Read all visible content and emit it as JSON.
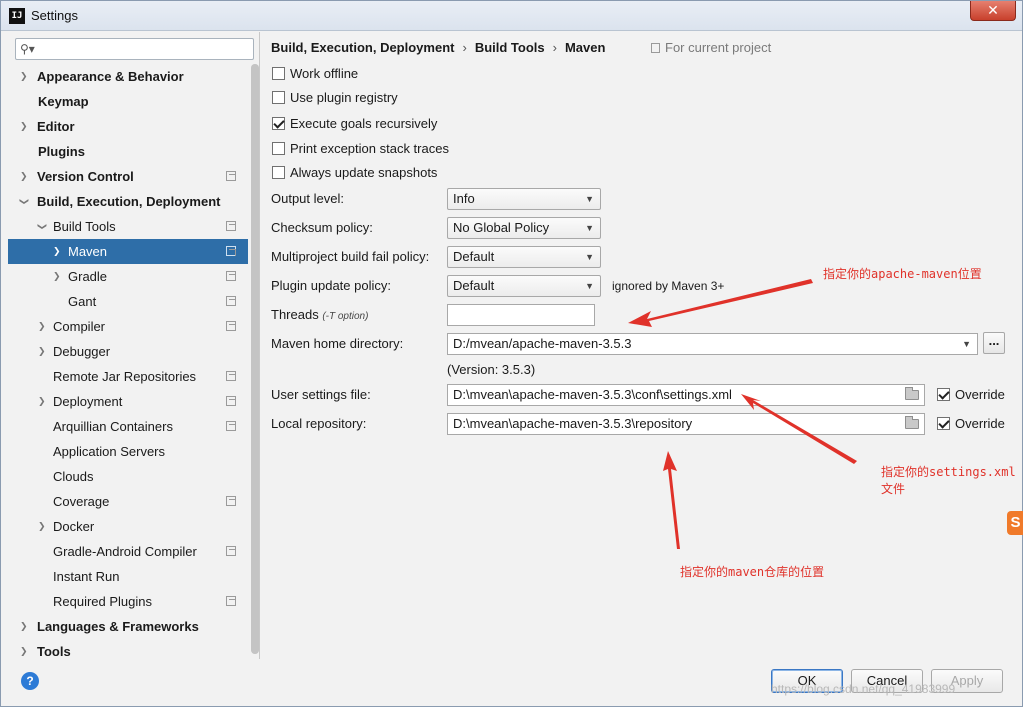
{
  "window": {
    "title": "Settings",
    "close_label": "✕"
  },
  "sidebar": {
    "search_placeholder": "",
    "items": [
      {
        "label": "Appearance & Behavior",
        "bold": true,
        "level": 0,
        "arrow": "right",
        "copy": false
      },
      {
        "label": "Keymap",
        "bold": true,
        "level": 0,
        "arrow": "none",
        "copy": false
      },
      {
        "label": "Editor",
        "bold": true,
        "level": 0,
        "arrow": "right",
        "copy": false
      },
      {
        "label": "Plugins",
        "bold": true,
        "level": 0,
        "arrow": "none",
        "copy": false
      },
      {
        "label": "Version Control",
        "bold": true,
        "level": 0,
        "arrow": "right",
        "copy": true
      },
      {
        "label": "Build, Execution, Deployment",
        "bold": true,
        "level": 0,
        "arrow": "down",
        "copy": false
      },
      {
        "label": "Build Tools",
        "bold": false,
        "level": 1,
        "arrow": "down",
        "copy": true
      },
      {
        "label": "Maven",
        "bold": false,
        "level": 2,
        "arrow": "right",
        "copy": true,
        "selected": true
      },
      {
        "label": "Gradle",
        "bold": false,
        "level": 2,
        "arrow": "right",
        "copy": true
      },
      {
        "label": "Gant",
        "bold": false,
        "level": 2,
        "arrow": "none",
        "copy": true
      },
      {
        "label": "Compiler",
        "bold": false,
        "level": 1,
        "arrow": "right",
        "copy": true
      },
      {
        "label": "Debugger",
        "bold": false,
        "level": 1,
        "arrow": "right",
        "copy": false
      },
      {
        "label": "Remote Jar Repositories",
        "bold": false,
        "level": 1,
        "arrow": "none",
        "copy": true
      },
      {
        "label": "Deployment",
        "bold": false,
        "level": 1,
        "arrow": "right",
        "copy": true
      },
      {
        "label": "Arquillian Containers",
        "bold": false,
        "level": 1,
        "arrow": "none",
        "copy": true
      },
      {
        "label": "Application Servers",
        "bold": false,
        "level": 1,
        "arrow": "none",
        "copy": false
      },
      {
        "label": "Clouds",
        "bold": false,
        "level": 1,
        "arrow": "none",
        "copy": false
      },
      {
        "label": "Coverage",
        "bold": false,
        "level": 1,
        "arrow": "none",
        "copy": true
      },
      {
        "label": "Docker",
        "bold": false,
        "level": 1,
        "arrow": "right",
        "copy": false
      },
      {
        "label": "Gradle-Android Compiler",
        "bold": false,
        "level": 1,
        "arrow": "none",
        "copy": true
      },
      {
        "label": "Instant Run",
        "bold": false,
        "level": 1,
        "arrow": "none",
        "copy": false
      },
      {
        "label": "Required Plugins",
        "bold": false,
        "level": 1,
        "arrow": "none",
        "copy": true
      },
      {
        "label": "Languages & Frameworks",
        "bold": true,
        "level": 0,
        "arrow": "right",
        "copy": false
      },
      {
        "label": "Tools",
        "bold": true,
        "level": 0,
        "arrow": "right",
        "copy": false
      }
    ]
  },
  "breadcrumb": {
    "parts": [
      "Build, Execution, Deployment",
      "Build Tools",
      "Maven"
    ],
    "separator": "›",
    "scope": "For current project"
  },
  "checkboxes": [
    {
      "label": "Work offline",
      "checked": false
    },
    {
      "label": "Use plugin registry",
      "checked": false
    },
    {
      "label": "Execute goals recursively",
      "checked": true
    },
    {
      "label": "Print exception stack traces",
      "checked": false
    },
    {
      "label": "Always update snapshots",
      "checked": false
    }
  ],
  "form": {
    "output_level": {
      "label": "Output level:",
      "value": "Info"
    },
    "checksum_policy": {
      "label": "Checksum policy:",
      "value": "No Global Policy"
    },
    "multiproject_fail": {
      "label": "Multiproject build fail policy:",
      "value": "Default"
    },
    "plugin_update": {
      "label": "Plugin update policy:",
      "value": "Default",
      "note": "ignored by Maven 3+"
    },
    "threads": {
      "label": "Threads",
      "hint": "(-T option)",
      "value": ""
    },
    "maven_home": {
      "label": "Maven home directory:",
      "value": "D:/mvean/apache-maven-3.5.3",
      "browse": "..."
    },
    "version": "(Version: 3.5.3)",
    "user_settings": {
      "label": "User settings file:",
      "value": "D:\\mvean\\apache-maven-3.5.3\\conf\\settings.xml",
      "override_label": "Override",
      "override_checked": true
    },
    "local_repo": {
      "label": "Local repository:",
      "value": "D:\\mvean\\apache-maven-3.5.3\\repository",
      "override_label": "Override",
      "override_checked": true
    }
  },
  "annotations": {
    "maven_home": "指定你的apache-maven位置",
    "settings_line1": "指定你的settings.xml",
    "settings_line2": "文件",
    "repository": "指定你的maven仓库的位置"
  },
  "buttons": {
    "ok": "OK",
    "cancel": "Cancel",
    "apply": "Apply",
    "help": "?"
  },
  "watermark": "https://blog.csdn.net/qq_41983999",
  "colors": {
    "selection": "#2e6ea8",
    "annotation": "#e0322a",
    "help": "#2d7bd6"
  }
}
